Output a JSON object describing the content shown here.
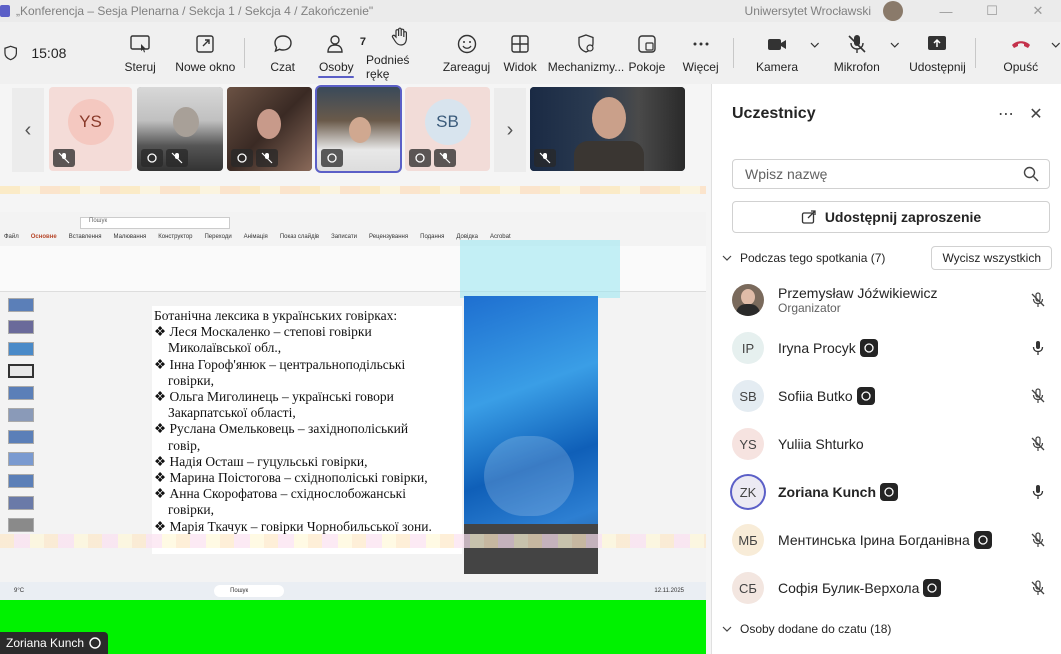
{
  "window": {
    "title": "„Konferencja – Sesja Plenarna / Sekcja 1 / Sekcja 4 / Zakończenie\"",
    "org": "Uniwersytet Wrocławski"
  },
  "toolbar": {
    "time": "15:08",
    "buttons": {
      "steruj": "Steruj",
      "nowe_okno": "Nowe okno",
      "czat": "Czat",
      "osoby": "Osoby",
      "osoby_count": "7",
      "reka": "Podnieś rękę",
      "zareaguj": "Zareaguj",
      "widok": "Widok",
      "mechanizmy": "Mechanizmy...",
      "pokoje": "Pokoje",
      "wiecej": "Więcej",
      "kamera": "Kamera",
      "mikrofon": "Mikrofon",
      "udostepnij": "Udostępnij",
      "opusc": "Opuść"
    }
  },
  "strip": {
    "tiles": [
      {
        "initials": "YS"
      },
      {
        "initials": ""
      },
      {
        "initials": ""
      },
      {
        "initials": ""
      },
      {
        "initials": "SB"
      },
      {
        "initials": ""
      }
    ]
  },
  "slide": {
    "lines": [
      "Ботанічна лексика в українських говірках:",
      "❖ Леся Москаленко – степові говірки",
      "Миколаївської обл.,",
      "❖ Інна Гороф'янюк – центральноподільські",
      "говірки,",
      "❖ Ольга Миголинець – українські говори",
      "Закарпатської області,",
      "❖ Руслана Омельковець – західнополіський",
      "говір,",
      "❖ Надія Осташ – гуцульські говірки,",
      "❖ Марина Поістогова – східнополіські говірки,",
      "❖ Анна Скорофатова – східнослобожанські",
      "говірки,",
      "❖ Марія Ткачук – говірки Чорнобильської зони."
    ],
    "app_search": "Пошук",
    "menu": [
      "Файл",
      "Основне",
      "Вставлення",
      "Малювання",
      "Конструктор",
      "Переходи",
      "Анімація",
      "Показ слайдів",
      "Записати",
      "Рецензування",
      "Подання",
      "Довідка",
      "Acrobat"
    ],
    "taskbar_search": "Пошук",
    "weather": "9°C",
    "date": "12.11.2025"
  },
  "stage": {
    "speaker_name": "Zoriana Kunch"
  },
  "panel": {
    "title": "Uczestnicy",
    "search_placeholder": "Wpisz nazwę",
    "invite": "Udostępnij zaproszenie",
    "in_meeting": "Podczas tego spotkania (7)",
    "mute_all": "Wycisz wszystkich",
    "people": [
      {
        "name": "Przemysław Jóźwikiewicz",
        "role": "Organizator",
        "initials": "",
        "avbg": "#7a6a5c",
        "raised": false,
        "muted": true
      },
      {
        "name": "Iryna Procyk",
        "role": "",
        "initials": "IP",
        "avbg": "#e6f0ef",
        "raised": true,
        "muted": false
      },
      {
        "name": "Sofiia Butko",
        "role": "",
        "initials": "SB",
        "avbg": "#e4ecf2",
        "raised": true,
        "muted": true
      },
      {
        "name": "Yuliia Shturko",
        "role": "",
        "initials": "YS",
        "avbg": "#f6e3e0",
        "raised": false,
        "muted": true
      },
      {
        "name": "Zoriana Kunch",
        "role": "",
        "initials": "ZK",
        "avbg": "#eceaf3",
        "raised": true,
        "muted": false
      },
      {
        "name": "Ментинська Ірина Богданівна",
        "role": "",
        "initials": "МБ",
        "avbg": "#f8ecd8",
        "raised": true,
        "muted": true
      },
      {
        "name": "Софія Булик-Верхола",
        "role": "",
        "initials": "СБ",
        "avbg": "#f3e6e0",
        "raised": true,
        "muted": true
      }
    ],
    "added_to_chat": "Osoby dodane do czatu (18)"
  },
  "colors": {
    "accent": "#5b5fc7",
    "leave": "#c4314b",
    "green_screen": "#00f200"
  }
}
